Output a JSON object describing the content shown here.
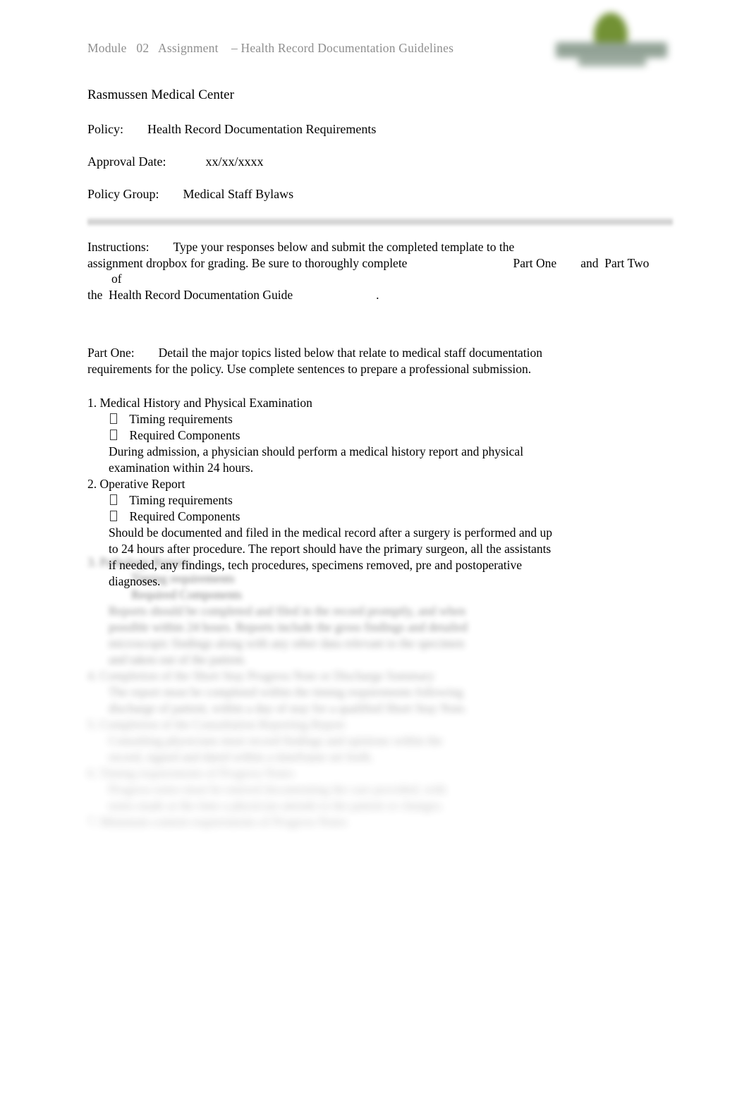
{
  "header": {
    "module_label": "Module   02   Assignment",
    "title_dash": "– Health Record Documentation Guidelines",
    "logo_name": "rasmussen-logo",
    "logo_leaf_color": "#6b8c2a",
    "logo_text_color": "#8d9e91"
  },
  "document": {
    "organization": "Rasmussen Medical Center",
    "policy_label": "Policy:",
    "policy_value": "Health Record Documentation Requirements",
    "approval_label": "Approval Date:",
    "approval_value": "xx/xx/xxxx",
    "policy_group_label": "Policy Group:",
    "policy_group_value": "Medical Staff Bylaws"
  },
  "instructions": {
    "label": "Instructions:",
    "line1": "Type your responses below and submit the completed template to the",
    "line2a": "assignment dropbox for grading. Be sure to thoroughly complete",
    "part_one": "Part One",
    "and": "and",
    "part_two": "Part Two",
    "of": "of",
    "line3a": "the",
    "guide_title": "Health Record Documentation Guide",
    "period": "."
  },
  "part_one": {
    "label": "Part One:",
    "description_line1": "Detail the major topics listed below that relate to medical staff documentation",
    "description_line2": "requirements for the policy. Use complete sentences to prepare a professional submission."
  },
  "topics": [
    {
      "heading": "1. Medical History and Physical Examination",
      "bullets": [
        "Timing requirements",
        "Required Components"
      ],
      "answer": "During admission, a physician should perform a medical history report and physical examination within 24 hours."
    },
    {
      "heading": "2. Operative Report",
      "bullets": [
        "Timing requirements",
        "Required Components"
      ],
      "answer": "Should be documented and filed in the medical record after a surgery is performed and up to 24 hours after procedure. The report should have the primary surgeon, all the assistants if needed, any findings, tech procedures, specimens removed, pre and postoperative diagnoses."
    }
  ],
  "obscured_tail": {
    "note": "remaining topics are blurred and illegible in the screenshot",
    "lines": [
      {
        "text": "3. Pathology Reports",
        "style": "b1"
      },
      {
        "text": "Timing requirements",
        "style": "b1",
        "indent": "bul"
      },
      {
        "text": "Required Components",
        "style": "b1",
        "indent": "bul"
      },
      {
        "text": "Reports should be completed and filed in the record promptly, and when",
        "style": "b2",
        "indent": "ind"
      },
      {
        "text": "possible within 24 hours. Reports include the gross findings and detailed",
        "style": "b2",
        "indent": "ind"
      },
      {
        "text": "microscopic findings along with any other data relevant to the specimen",
        "style": "b3",
        "indent": "ind"
      },
      {
        "text": "and taken out of the patient.",
        "style": "b3",
        "indent": "ind"
      },
      {
        "text": "4. Completion of the Short Stay Progress Note or Discharge Summary",
        "style": "b4"
      },
      {
        "text": "The report must be completed within the timing requirements following",
        "style": "b4",
        "indent": "ind"
      },
      {
        "text": "discharge of patient, within a day of stay for a qualified Short Stay Note.",
        "style": "b4",
        "indent": "ind"
      },
      {
        "text": "5. Completion of the Consultation Reporting Report",
        "style": "b5"
      },
      {
        "text": "Consulting physicians must record findings and opinions within the",
        "style": "b5",
        "indent": "ind"
      },
      {
        "text": "record, signed and dated within a timeframe set forth.",
        "style": "b5",
        "indent": "ind"
      },
      {
        "text": "6. Timing requirements of Progress Notes",
        "style": "b6"
      },
      {
        "text": "Progress notes must be entered documenting the care provided, with",
        "style": "b6",
        "indent": "ind"
      },
      {
        "text": "notes made at the time a physician attends to the patient or changes.",
        "style": "b6",
        "indent": "ind"
      },
      {
        "text": "7. Minimum content requirements of Progress Notes",
        "style": "b6"
      }
    ]
  }
}
